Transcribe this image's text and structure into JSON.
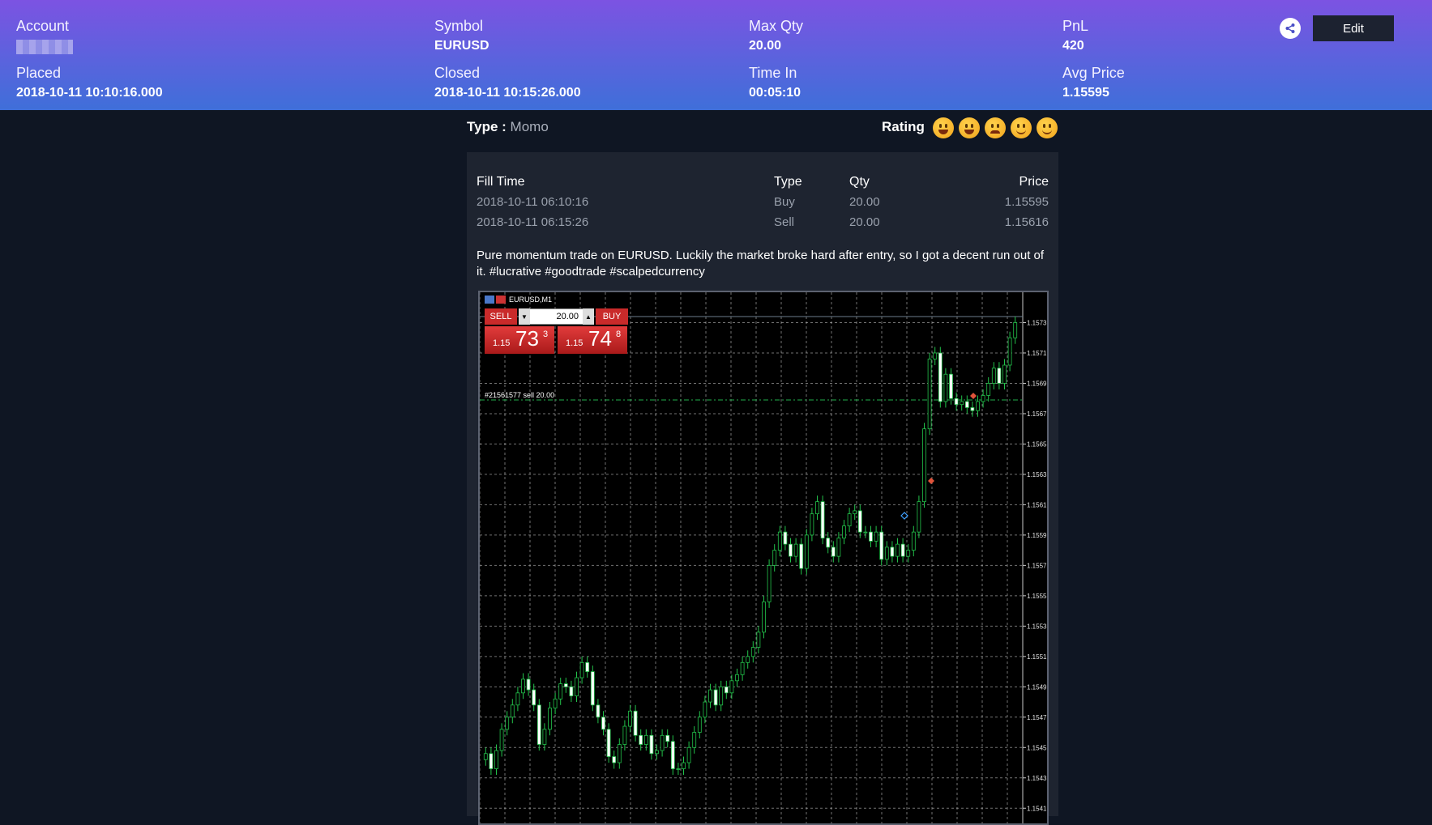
{
  "header": {
    "account": {
      "label": "Account"
    },
    "symbol": {
      "label": "Symbol",
      "value": "EURUSD"
    },
    "max_qty": {
      "label": "Max Qty",
      "value": "20.00"
    },
    "pnl": {
      "label": "PnL",
      "value": "420"
    },
    "placed": {
      "label": "Placed",
      "value": "2018-10-11 10:10:16.000"
    },
    "closed": {
      "label": "Closed",
      "value": "2018-10-11 10:15:26.000"
    },
    "time_in": {
      "label": "Time In",
      "value": "00:05:10"
    },
    "avg_price": {
      "label": "Avg Price",
      "value": "1.15595"
    },
    "edit_label": "Edit"
  },
  "trade": {
    "type_label": "Type :",
    "type_value": "Momo",
    "rating_label": "Rating"
  },
  "fills": {
    "headers": [
      "Fill Time",
      "Type",
      "Qty",
      "Price"
    ],
    "rows": [
      [
        "2018-10-11 06:10:16",
        "Buy",
        "20.00",
        "1.15595"
      ],
      [
        "2018-10-11 06:15:26",
        "Sell",
        "20.00",
        "1.15616"
      ]
    ]
  },
  "note": "Pure momentum trade on EURUSD. Luckily the market broke hard after entry, so I got a decent run out of it. #lucrative #goodtrade #scalpedcurrency",
  "chart_data": {
    "type": "candlestick",
    "title": "EURUSD,M1",
    "order_line_label": "#21561577 sell 20.00",
    "y_ticks": [
      "1.1573",
      "1.1571",
      "1.1569",
      "1.1567",
      "1.1565",
      "1.1563",
      "1.1561",
      "1.1559",
      "1.1557",
      "1.1555",
      "1.1553",
      "1.1551",
      "1.1549",
      "1.1547",
      "1.1545",
      "1.1543",
      "1.1541"
    ],
    "ylim": [
      1.154,
      1.1575
    ],
    "trade_panel": {
      "sell_label": "SELL",
      "buy_label": "BUY",
      "volume": "20.00",
      "bid_prefix": "1.15",
      "bid_big": "73",
      "bid_sup": "3",
      "ask_prefix": "1.15",
      "ask_big": "74",
      "ask_sup": "8"
    },
    "closes": [
      1.15446,
      1.15436,
      1.15448,
      1.15462,
      1.1547,
      1.15478,
      1.15486,
      1.15495,
      1.15488,
      1.15478,
      1.15452,
      1.15462,
      1.15476,
      1.15482,
      1.15492,
      1.1549,
      1.15484,
      1.15496,
      1.15506,
      1.155,
      1.15478,
      1.1547,
      1.15462,
      1.15444,
      1.1544,
      1.15452,
      1.15464,
      1.15474,
      1.15458,
      1.15452,
      1.15458,
      1.15446,
      1.15448,
      1.15458,
      1.15454,
      1.15436,
      1.15436,
      1.1544,
      1.1545,
      1.1546,
      1.1547,
      1.1548,
      1.15488,
      1.15478,
      1.1549,
      1.15486,
      1.15494,
      1.15498,
      1.15506,
      1.1551,
      1.15516,
      1.15526,
      1.15546,
      1.1557,
      1.1558,
      1.15592,
      1.15584,
      1.15576,
      1.15584,
      1.15568,
      1.1559,
      1.15604,
      1.15612,
      1.15588,
      1.15582,
      1.15576,
      1.15588,
      1.15596,
      1.15604,
      1.15606,
      1.15592,
      1.15592,
      1.15586,
      1.15592,
      1.15574,
      1.15582,
      1.15576,
      1.15584,
      1.15576,
      1.1558,
      1.15592,
      1.15612,
      1.1566,
      1.15706,
      1.1571,
      1.15678,
      1.15696,
      1.1568,
      1.15676,
      1.15678,
      1.15674,
      1.15672,
      1.15678,
      1.15682,
      1.1569,
      1.157,
      1.1569,
      1.15702,
      1.1572,
      1.1573
    ]
  }
}
